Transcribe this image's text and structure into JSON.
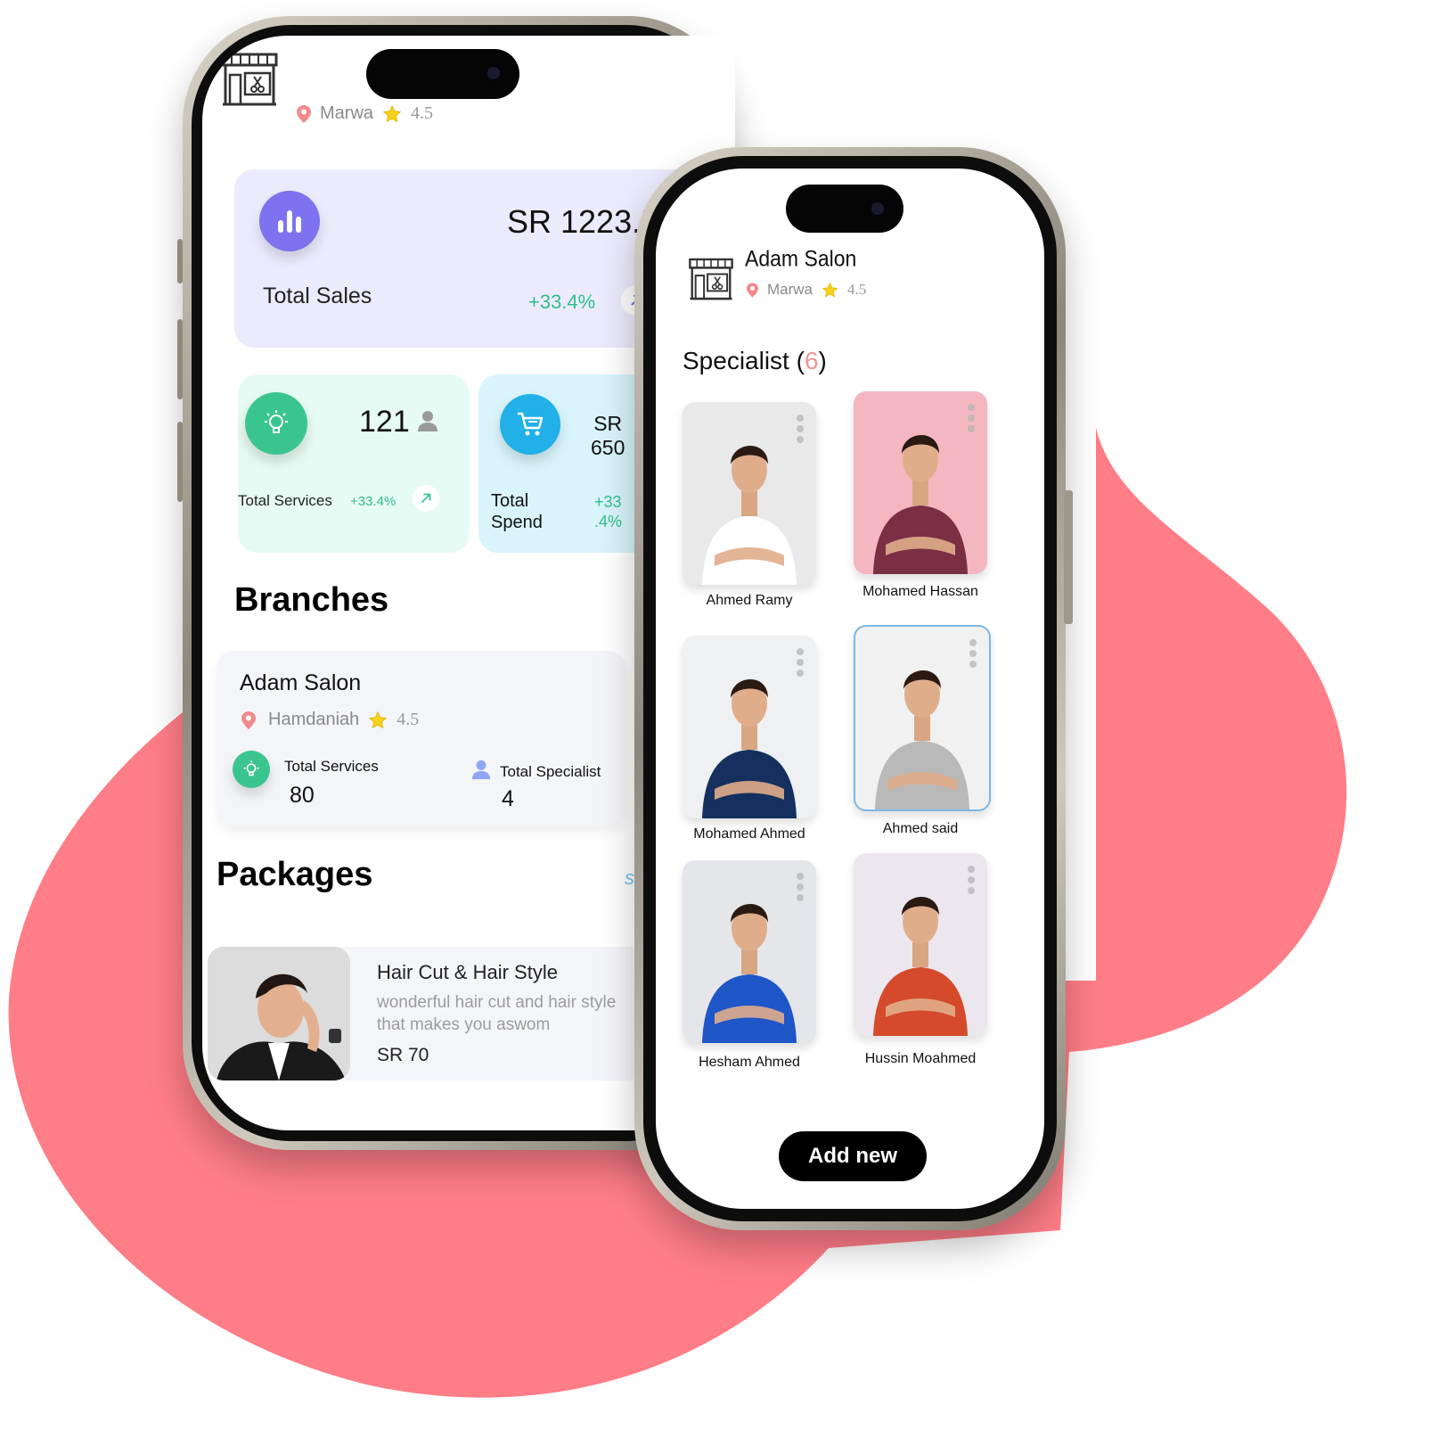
{
  "colors": {
    "blob": "#ff7d87",
    "accent_green": "#2fbf8a",
    "accent_purple": "#7d73f0",
    "accent_blue": "#22b0e8",
    "pin_red": "#f08a8a",
    "star_yellow": "#f6d21c"
  },
  "left_phone": {
    "header": {
      "location": "Marwa",
      "rating": "4.5",
      "shop_icon": "barber-shop-icon"
    },
    "total_sales": {
      "value": "SR 1223.5",
      "label": "Total Sales",
      "change": "+33.4%",
      "icon": "bar-chart-icon"
    },
    "total_services": {
      "value": "121",
      "label": "Total Services",
      "change": "+33.4%",
      "icon": "lightbulb-icon"
    },
    "total_spend": {
      "value_line1": "SR",
      "value_line2": "650",
      "label_line1": "Total",
      "label_line2": "Spend",
      "change_line1": "+33",
      "change_line2": ".4%",
      "icon": "cart-icon"
    },
    "branches": {
      "title": "Branches",
      "card": {
        "name": "Adam Salon",
        "location": "Hamdaniah",
        "rating": "4.5",
        "services_label": "Total Services",
        "services_value": "80",
        "specialist_label": "Total Specialist",
        "specialist_value": "4"
      }
    },
    "packages": {
      "title": "Packages",
      "see_link": "se",
      "item": {
        "title": "Hair Cut & Hair Style",
        "description": "wonderful hair cut and hair style that makes you aswom",
        "price": "SR 70"
      }
    }
  },
  "right_phone": {
    "header": {
      "title": "Adam Salon",
      "location": "Marwa",
      "rating": "4.5"
    },
    "specialist": {
      "title": "Specialist",
      "count": "6"
    },
    "specialists": [
      {
        "name": "Ahmed Ramy",
        "bg": "#e9e9e9",
        "shirt": "#ffffff"
      },
      {
        "name": "Mohamed Hassan",
        "bg": "#f4b7bf",
        "shirt": "#7b2f45"
      },
      {
        "name": "Mohamed Ahmed",
        "bg": "#eef0f2",
        "shirt": "#15305f"
      },
      {
        "name": "Ahmed said",
        "bg": "#f1f1f1",
        "shirt": "#b9b9b9"
      },
      {
        "name": "Hesham Ahmed",
        "bg": "#e4e6ea",
        "shirt": "#1f56c8"
      },
      {
        "name": "Hussin Moahmed",
        "bg": "#ece6ee",
        "shirt": "#d44a2a"
      }
    ],
    "add_button": "Add new"
  }
}
